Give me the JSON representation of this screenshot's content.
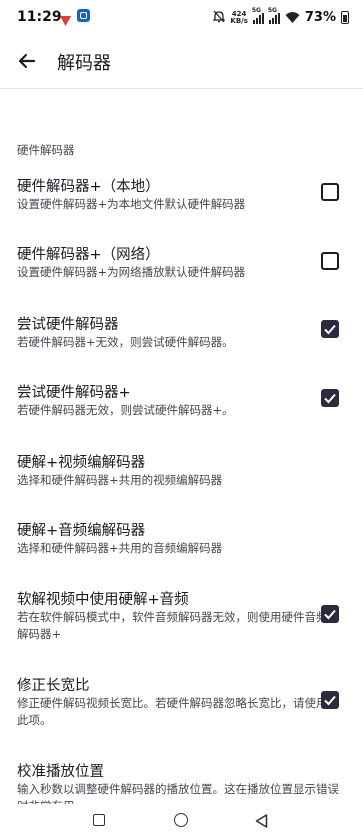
{
  "status_bar": {
    "time": "11:29",
    "net_speed_value": "424",
    "net_speed_unit": "KB/s",
    "sig1_tech": "5G",
    "sig2_tech": "5G",
    "battery": "73%"
  },
  "app_bar": {
    "title": "解码器"
  },
  "section": {
    "header": "硬件解码器"
  },
  "items": [
    {
      "title": "硬件解码器+（本地）",
      "subtitle": "设置硬件解码器+为本地文件默认硬件解码器",
      "checked": false
    },
    {
      "title": "硬件解码器+（网络）",
      "subtitle": "设置硬件解码器+为网络播放默认硬件解码器",
      "checked": false
    },
    {
      "title": "尝试硬件解码器",
      "subtitle": "若硬件解码器+无效，则尝试硬件解码器。",
      "checked": true
    },
    {
      "title": "尝试硬件解码器+",
      "subtitle": "若硬件解码器无效，则尝试硬件解码器+。",
      "checked": true
    },
    {
      "title": "硬解+视频编解码器",
      "subtitle": "选择和硬件解码器+共用的视频编解码器"
    },
    {
      "title": "硬解+音频编解码器",
      "subtitle": "选择和硬件解码器+共用的音频编解码器"
    },
    {
      "title": "软解视频中使用硬解+音频",
      "subtitle": "若在软件解码模式中，软件音频解码器无效，则使用硬件音频解码器+",
      "checked": true
    },
    {
      "title": "修正长宽比",
      "subtitle": "修正硬件解码视频长宽比。若硬件解码器忽略长宽比，请使用此项。",
      "checked": true
    },
    {
      "title": "校准播放位置",
      "subtitle": "输入秒数以调整硬件解码器的播放位置。这在播放位置显示错误时非常有用。"
    }
  ],
  "icons": {
    "back": "arrow-back-icon",
    "nav_recents": "square-icon",
    "nav_home": "circle-icon",
    "nav_back": "triangle-back-icon",
    "checkbox_on_color": "#2e2a3d"
  }
}
